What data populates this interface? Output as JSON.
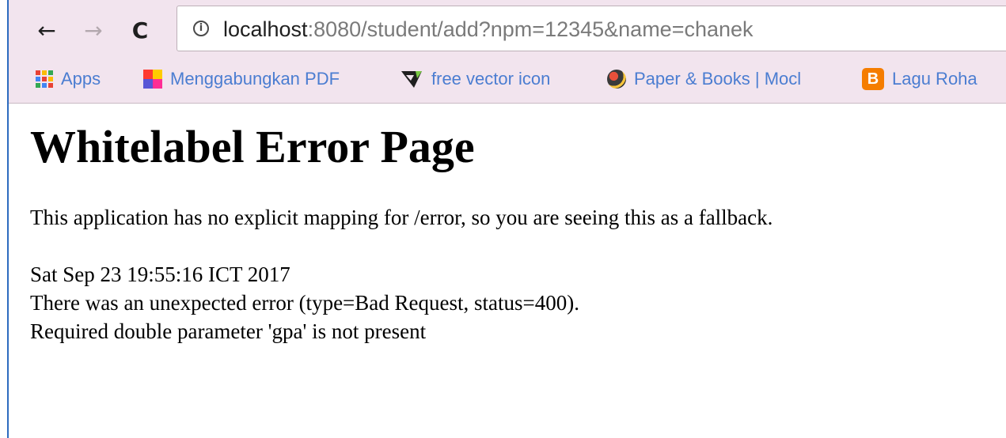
{
  "browser": {
    "url_host": "localhost",
    "url_rest": ":8080/student/add?npm=12345&name=chanek",
    "bookmarks": [
      {
        "label": "Apps",
        "icon": "apps-grid-icon"
      },
      {
        "label": "Menggabungkan PDF",
        "icon": "pdf-merge-icon"
      },
      {
        "label": "free vector icon",
        "icon": "vector-logo-icon"
      },
      {
        "label": "Paper & Books | Mocl",
        "icon": "globe-icon"
      },
      {
        "label": "Lagu Roha",
        "icon": "blogger-icon"
      }
    ]
  },
  "page": {
    "title": "Whitelabel Error Page",
    "message": "This application has no explicit mapping for /error, so you are seeing this as a fallback.",
    "timestamp": "Sat Sep 23 19:55:16 ICT 2017",
    "error_line": "There was an unexpected error (type=Bad Request, status=400).",
    "detail": "Required double parameter 'gpa' is not present"
  },
  "colors": {
    "chrome_bg": "#f2e4ee",
    "bookmark_text": "#4b7dd1",
    "window_edge": "#2d6bbf"
  }
}
